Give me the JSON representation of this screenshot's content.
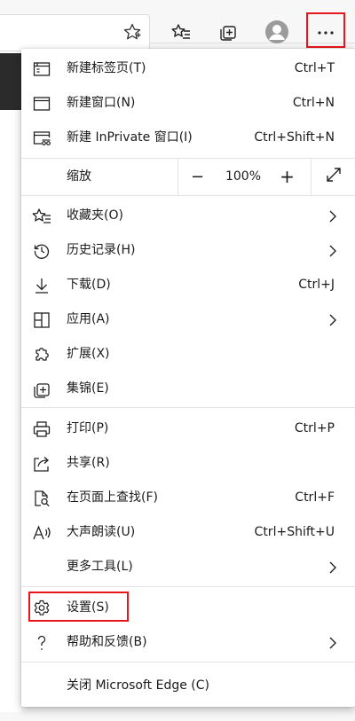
{
  "toolbar": {
    "address_star_icon": "favorite-star-icon",
    "favorites_icon": "favorites-list-icon",
    "collections_icon": "collections-icon",
    "profile_icon": "profile-avatar-icon",
    "more_icon": "more-ellipsis-icon",
    "highlight_color": "#e8161b"
  },
  "menu": {
    "new_tab": {
      "label": "新建标签页(T)",
      "shortcut": "Ctrl+T"
    },
    "new_window": {
      "label": "新建窗口(N)",
      "shortcut": "Ctrl+N"
    },
    "new_inprivate": {
      "label": "新建 InPrivate 窗口(I)",
      "shortcut": "Ctrl+Shift+N"
    },
    "zoom": {
      "label": "缩放",
      "minus": "−",
      "value": "100%",
      "plus": "+"
    },
    "favorites": {
      "label": "收藏夹(O)"
    },
    "history": {
      "label": "历史记录(H)"
    },
    "downloads": {
      "label": "下载(D)",
      "shortcut": "Ctrl+J"
    },
    "apps": {
      "label": "应用(A)"
    },
    "extensions": {
      "label": "扩展(X)"
    },
    "collections": {
      "label": "集锦(E)"
    },
    "print": {
      "label": "打印(P)",
      "shortcut": "Ctrl+P"
    },
    "share": {
      "label": "共享(R)"
    },
    "find": {
      "label": "在页面上查找(F)",
      "shortcut": "Ctrl+F"
    },
    "read_aloud": {
      "label": "大声朗读(U)",
      "shortcut": "Ctrl+Shift+U"
    },
    "more_tools": {
      "label": "更多工具(L)"
    },
    "settings": {
      "label": "设置(S)"
    },
    "help": {
      "label": "帮助和反馈(B)"
    },
    "close": {
      "label": "关闭 Microsoft Edge (C)"
    }
  }
}
